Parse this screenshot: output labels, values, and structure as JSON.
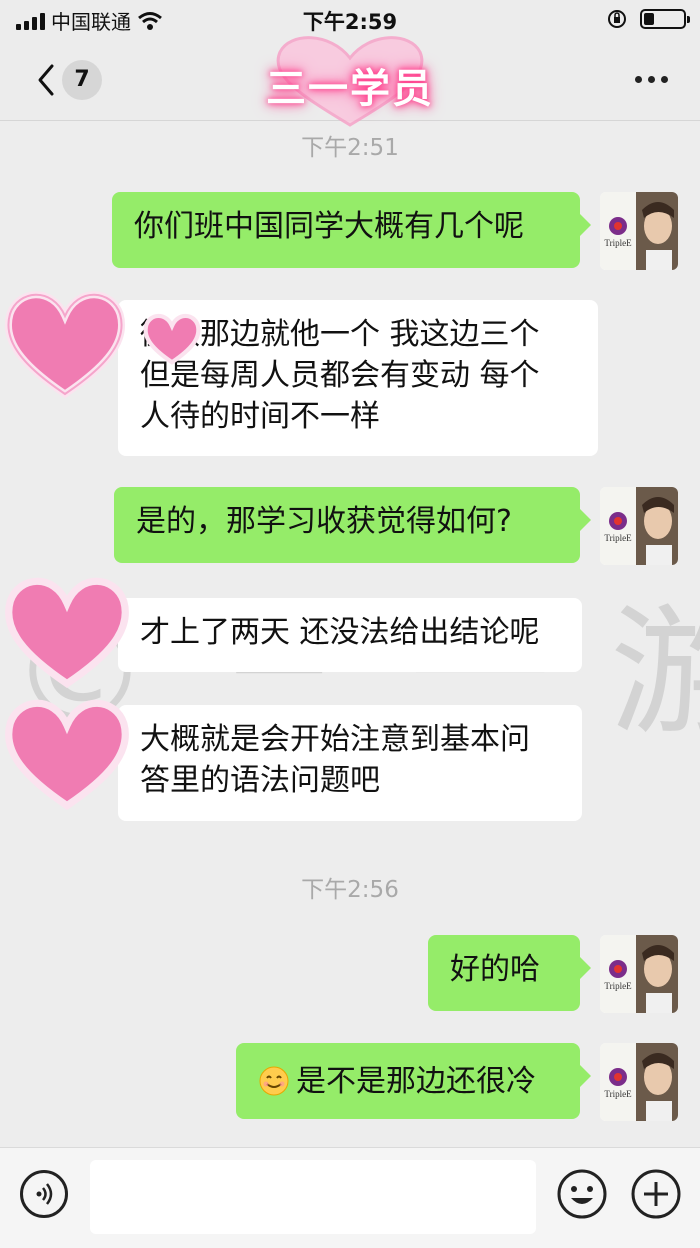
{
  "status_bar": {
    "carrier": "中国联通",
    "time": "下午2:59"
  },
  "nav": {
    "unread_count": "7",
    "title": "三一学员"
  },
  "messages": [
    {
      "type": "timestamp",
      "text": "下午2:51"
    },
    {
      "type": "sent",
      "lines": [
        "你们班中国同学大概有几个呢"
      ]
    },
    {
      "type": "received",
      "lines": [
        "微微那边就他一个 我这边三个",
        "但是每周人员都会有变动 每个",
        "人待的时间不一样"
      ]
    },
    {
      "type": "sent",
      "lines": [
        "是的，那学习收获觉得如何?"
      ]
    },
    {
      "type": "received",
      "lines": [
        "才上了两天 还没法给出结论呢"
      ]
    },
    {
      "type": "received",
      "lines": [
        "大概就是会开始注意到基本问",
        "答里的语法问题吧"
      ]
    },
    {
      "type": "timestamp",
      "text": "下午2:56"
    },
    {
      "type": "sent",
      "lines": [
        "好的哈"
      ]
    },
    {
      "type": "sent",
      "emoji": "smiling-face",
      "lines": [
        "是不是那边还很冷"
      ]
    }
  ],
  "avatar": {
    "brand": "TripleE"
  },
  "watermark": "©三一游学",
  "colors": {
    "sent_bubble": "#95ec69",
    "received_bubble": "#ffffff",
    "background": "#ededed",
    "heart_pink": "#f48fc0"
  }
}
